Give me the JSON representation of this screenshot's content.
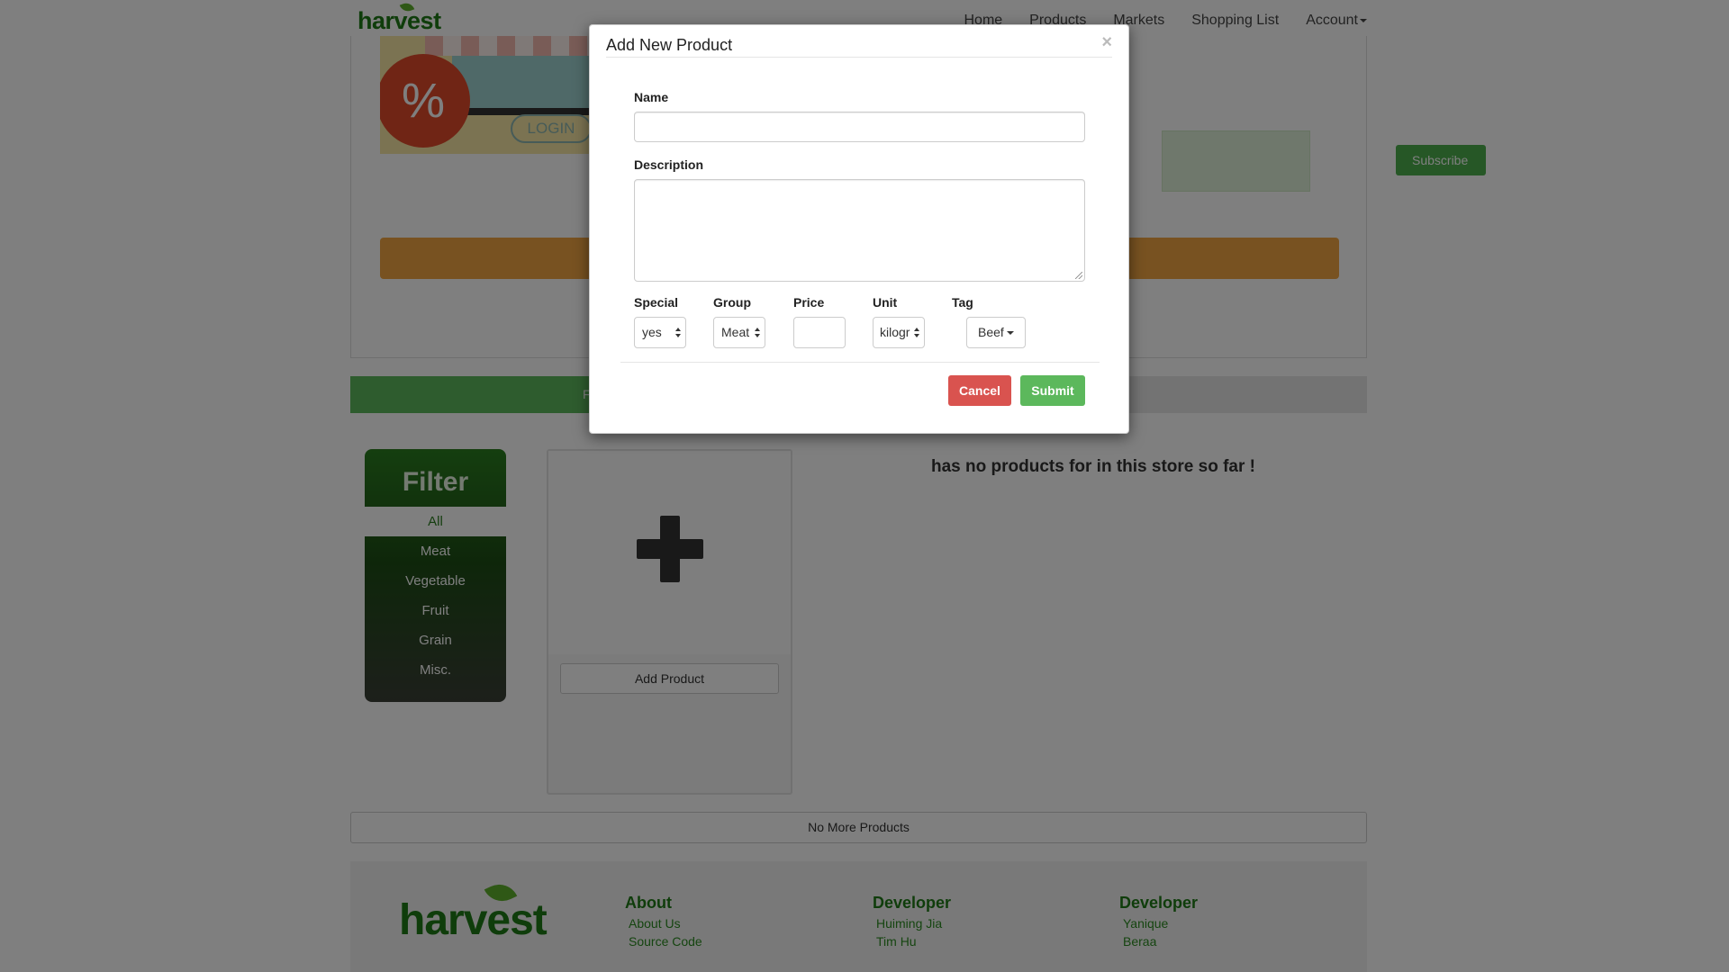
{
  "navbar": {
    "brand": "harvest",
    "links": [
      "Home",
      "Products",
      "Markets",
      "Shopping List",
      "Account"
    ]
  },
  "hero": {
    "login_text": "LOGIN",
    "percent_symbol": "%",
    "subscribe_label": "Subscribe"
  },
  "tabs": {
    "active_label": "F"
  },
  "filter": {
    "title": "Filter",
    "items": [
      "All",
      "Meat",
      "Vegetable",
      "Fruit",
      "Grain",
      "Misc."
    ],
    "selected": "All"
  },
  "products": {
    "add_button_label": "Add Product",
    "empty_message": "has no products for in this store so far !",
    "no_more_label": "No More Products"
  },
  "footer": {
    "logo": "harvest",
    "columns": [
      {
        "title": "About",
        "links": [
          "About Us",
          "Source Code"
        ]
      },
      {
        "title": "Developer",
        "links": [
          "Huiming Jia",
          "Tim Hu"
        ]
      },
      {
        "title": "Developer",
        "links": [
          "Yanique",
          "Beraa"
        ]
      }
    ]
  },
  "modal": {
    "title": "Add New Product",
    "close_symbol": "×",
    "name_label": "Name",
    "name_value": "",
    "description_label": "Description",
    "description_value": "",
    "special_label": "Special",
    "special_value": "yes",
    "group_label": "Group",
    "group_value": "Meat",
    "price_label": "Price",
    "price_value": "",
    "unit_label": "Unit",
    "unit_value": "kilogr",
    "tag_label": "Tag",
    "tag_value": "Beef",
    "cancel_label": "Cancel",
    "submit_label": "Submit"
  },
  "colors": {
    "brand_green": "#1e7a16",
    "success": "#5cb85c",
    "danger": "#d9534f",
    "accent_orange": "#f0a542"
  }
}
